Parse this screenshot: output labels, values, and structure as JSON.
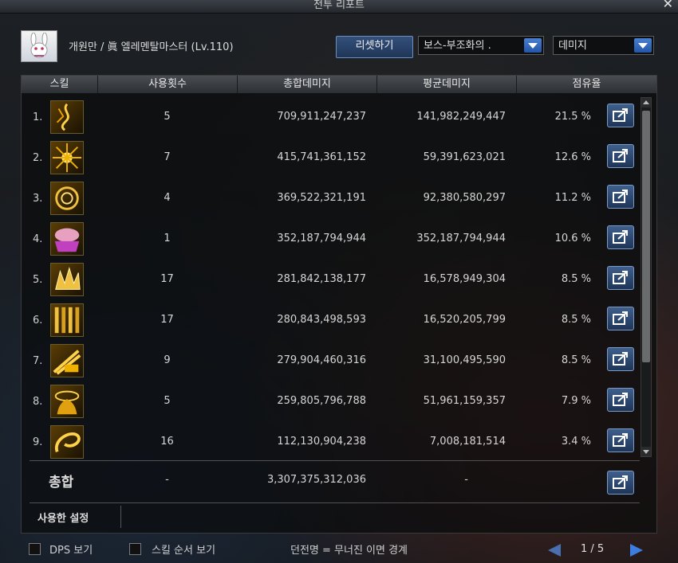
{
  "window": {
    "title": "전투 리포트"
  },
  "header": {
    "character": "개원만 / 眞 엘레멘탈마스터 (Lv.110)",
    "reset_label": "리셋하기",
    "mode_value": "보스-부조화의 .",
    "metric_value": "데미지"
  },
  "columns": [
    "스킬",
    "사용횟수",
    "총합데미지",
    "평균데미지",
    "점유율"
  ],
  "rows": [
    {
      "rank": "1.",
      "uses": "5",
      "total": "709,911,247,237",
      "avg": "141,982,249,447",
      "pct": "21.5 %",
      "icon": "fire-spiral-skill-icon"
    },
    {
      "rank": "2.",
      "uses": "7",
      "total": "415,741,361,152",
      "avg": "59,391,623,021",
      "pct": "12.6 %",
      "icon": "burst-skill-icon"
    },
    {
      "rank": "3.",
      "uses": "4",
      "total": "369,522,321,191",
      "avg": "92,380,580,297",
      "pct": "11.2 %",
      "icon": "vortex-skill-icon"
    },
    {
      "rank": "4.",
      "uses": "1",
      "total": "352,187,794,944",
      "avg": "352,187,794,944",
      "pct": "10.6 %",
      "icon": "dome-skill-icon"
    },
    {
      "rank": "5.",
      "uses": "17",
      "total": "281,842,138,177",
      "avg": "16,578,949,304",
      "pct": "8.5 %",
      "icon": "crystal-skill-icon"
    },
    {
      "rank": "6.",
      "uses": "17",
      "total": "280,843,498,593",
      "avg": "16,520,205,799",
      "pct": "8.5 %",
      "icon": "pillars-skill-icon"
    },
    {
      "rank": "7.",
      "uses": "9",
      "total": "279,904,460,316",
      "avg": "31,100,495,590",
      "pct": "8.5 %",
      "icon": "slash-skill-icon"
    },
    {
      "rank": "8.",
      "uses": "5",
      "total": "259,805,796,788",
      "avg": "51,961,159,357",
      "pct": "7.9 %",
      "icon": "flame-ring-skill-icon"
    },
    {
      "rank": "9.",
      "uses": "16",
      "total": "112,130,904,238",
      "avg": "7,008,181,514",
      "pct": "3.4 %",
      "icon": "whirl-skill-icon"
    }
  ],
  "summary": {
    "label": "총합",
    "uses": "-",
    "total": "3,307,375,312,036",
    "avg": "-"
  },
  "settings": {
    "label": "사용한 설정"
  },
  "footer": {
    "dps_label": "DPS 보기",
    "order_label": "스킬 순서 보기",
    "dungeon": "던전명 = 무너진 이면 경계",
    "page": "1 / 5"
  },
  "colors": {
    "accent": "#3e7de0",
    "panel": "#0a0b0d",
    "button": "#2c4a74"
  }
}
